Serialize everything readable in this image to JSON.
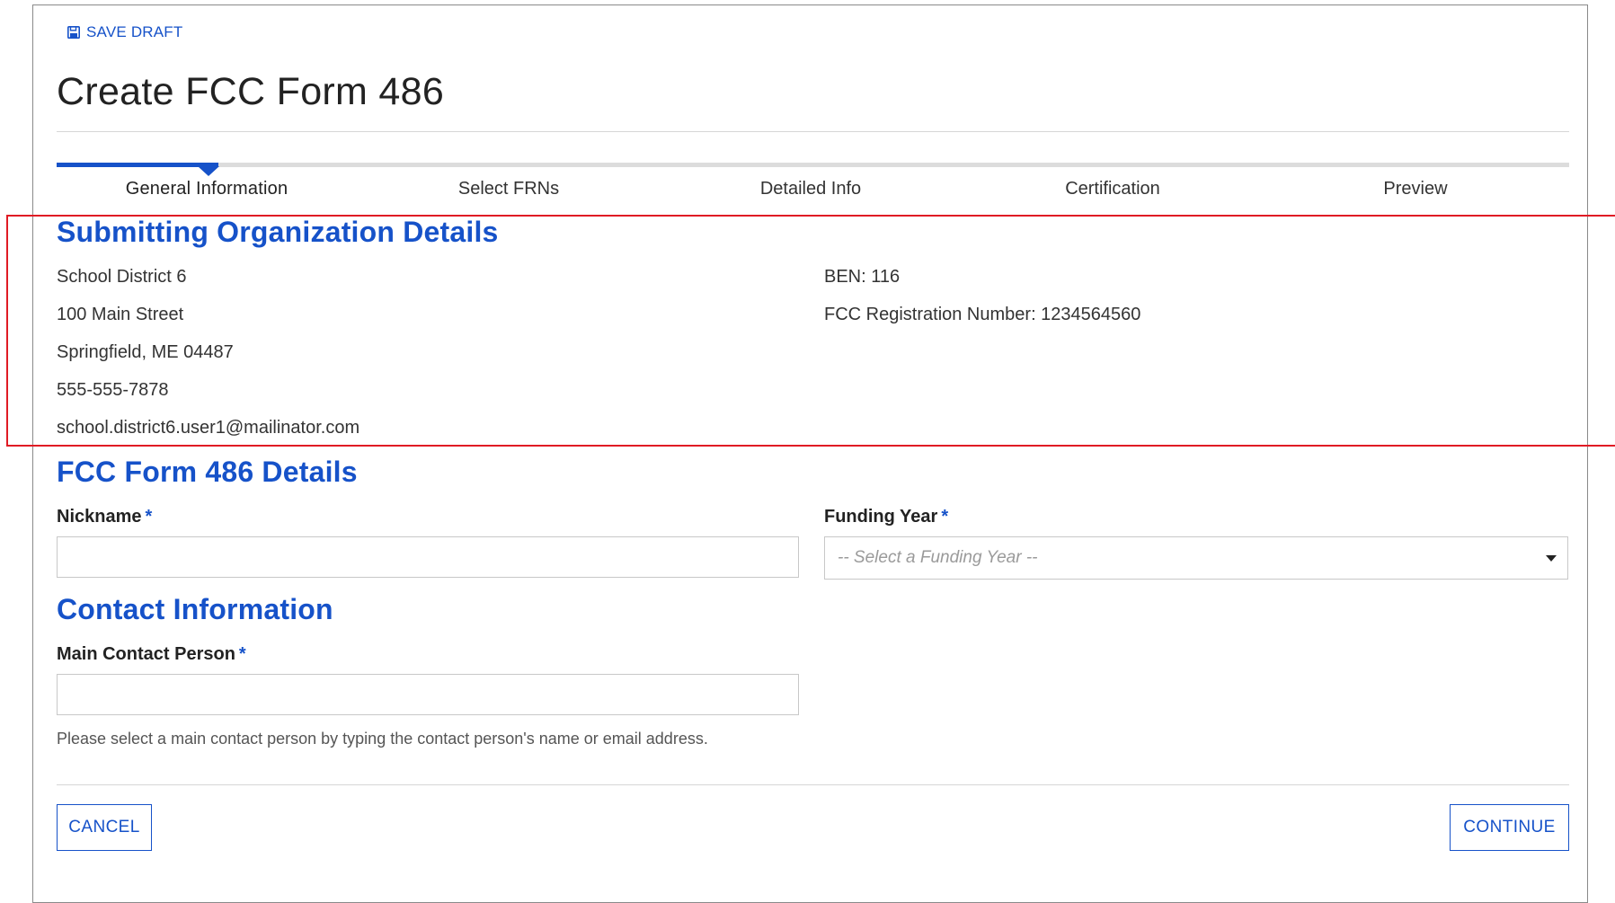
{
  "toolbar": {
    "save_draft_label": "SAVE DRAFT",
    "save_icon": "floppy-disk-icon"
  },
  "page": {
    "title": "Create FCC Form 486"
  },
  "stepper": {
    "steps": [
      "General Information",
      "Select FRNs",
      "Detailed Info",
      "Certification",
      "Preview"
    ],
    "active_step": "General Information"
  },
  "org_details": {
    "heading": "Submitting Organization Details",
    "name": "School District 6",
    "street": "100 Main Street",
    "city_state_zip": "Springfield, ME 04487",
    "phone": "555-555-7878",
    "email": "school.district6.user1@mailinator.com",
    "ben": "BEN: 116",
    "fcc_registration": "FCC Registration Number: 1234564560"
  },
  "form_details": {
    "heading": "FCC Form 486 Details",
    "nickname_label": "Nickname",
    "nickname_value": "",
    "funding_year_label": "Funding Year",
    "funding_year_placeholder": "-- Select a Funding Year --",
    "required_marker": "*"
  },
  "contact": {
    "heading": "Contact Information",
    "main_contact_label": "Main Contact Person",
    "main_contact_value": "",
    "help_text": "Please select a main contact person by typing the contact person's name or email address."
  },
  "actions": {
    "cancel_label": "CANCEL",
    "continue_label": "CONTINUE"
  },
  "colors": {
    "accent": "#1652c9",
    "highlight": "#e01b24",
    "text": "#333333"
  }
}
